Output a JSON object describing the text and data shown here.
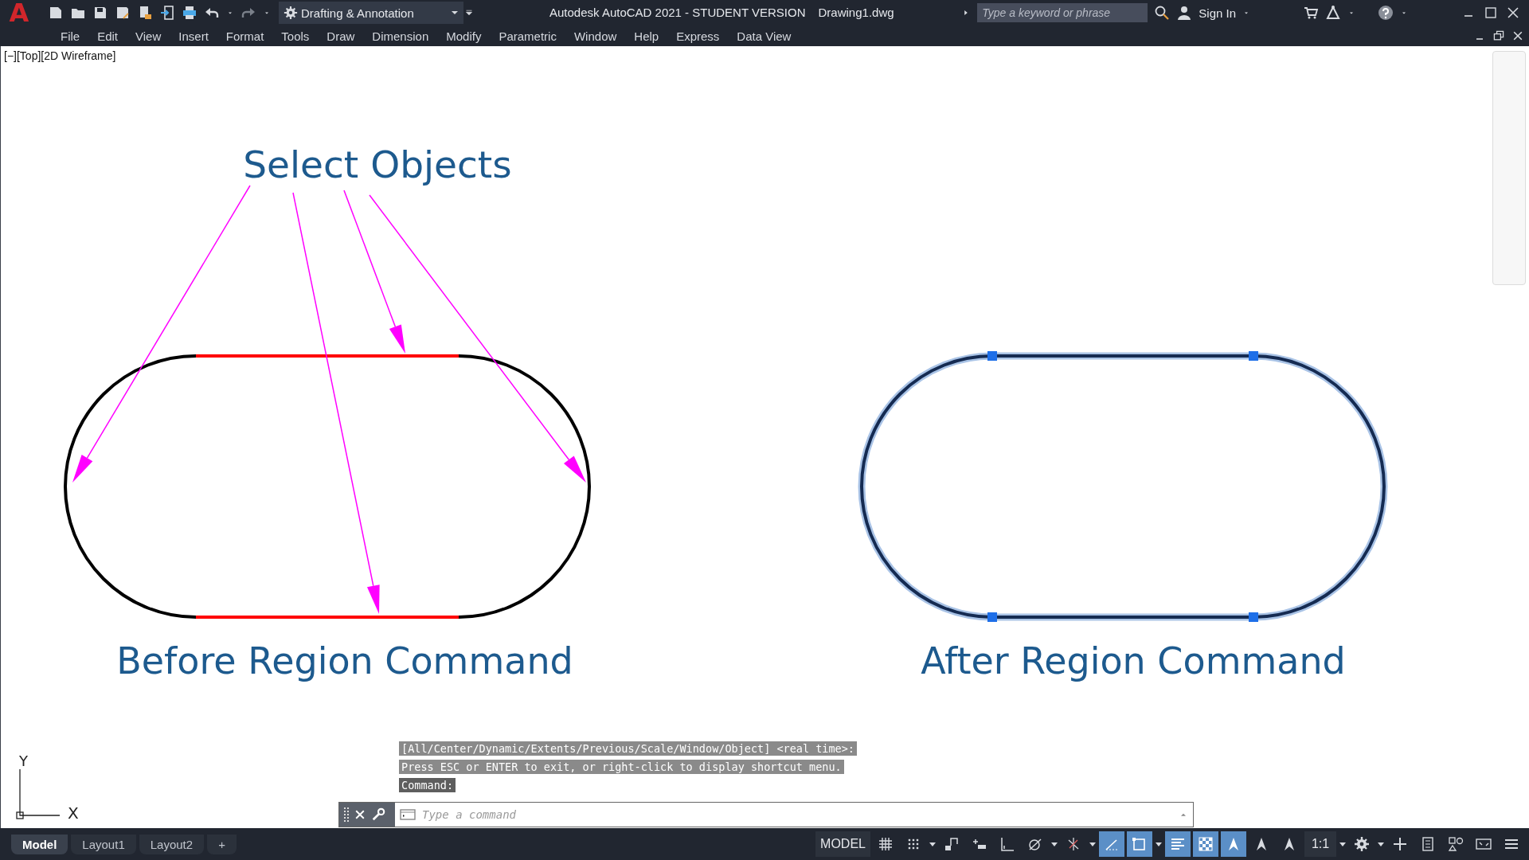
{
  "app": {
    "logo": "A",
    "workspace": "Drafting & Annotation",
    "title": "Autodesk AutoCAD 2021 - STUDENT VERSION",
    "file": "Drawing1.dwg",
    "search": {
      "placeholder": "Type a keyword or phrase"
    },
    "sign_in": "Sign In"
  },
  "menu": [
    "File",
    "Edit",
    "View",
    "Insert",
    "Format",
    "Tools",
    "Draw",
    "Dimension",
    "Modify",
    "Parametric",
    "Window",
    "Help",
    "Express",
    "Data View"
  ],
  "viewport_label": "[−][Top][2D Wireframe]",
  "drawing": {
    "callout": "Select Objects",
    "before_label": "Before Region Command",
    "after_label": "After Region Command"
  },
  "ucs": {
    "y": "Y",
    "x": "X"
  },
  "command_history": [
    {
      "text": "[All/Center/Dynamic/Extents/Previous/Scale/Window/Object] <real time>:",
      "kind": "prompt"
    },
    {
      "text": "Press ESC or ENTER to exit, or right-click to display shortcut menu.",
      "kind": "prompt"
    },
    {
      "text": "Command:",
      "kind": "command"
    }
  ],
  "command_line": {
    "placeholder": "Type a command"
  },
  "layout_tabs": [
    {
      "label": "Model",
      "selected": true
    },
    {
      "label": "Layout1",
      "selected": false
    },
    {
      "label": "Layout2",
      "selected": false
    },
    {
      "label": "+",
      "selected": false
    }
  ],
  "status_bar": [
    {
      "kind": "label",
      "text": "MODEL",
      "on": false
    },
    {
      "kind": "grid",
      "on": false
    },
    {
      "kind": "dots",
      "on": false
    },
    {
      "kind": "caret",
      "on": false
    },
    {
      "kind": "step",
      "on": false
    },
    {
      "kind": "infer",
      "on": false
    },
    {
      "kind": "ortho",
      "on": false
    },
    {
      "kind": "polar",
      "on": false
    },
    {
      "kind": "caret",
      "on": false
    },
    {
      "kind": "iso",
      "on": false
    },
    {
      "kind": "caret",
      "on": false
    },
    {
      "kind": "track",
      "on": true
    },
    {
      "kind": "osnap",
      "on": true
    },
    {
      "kind": "caret",
      "on": false
    },
    {
      "kind": "lines",
      "on": true
    },
    {
      "kind": "checker",
      "on": true
    },
    {
      "kind": "annot",
      "on": true
    },
    {
      "kind": "annot",
      "on": false
    },
    {
      "kind": "annot",
      "on": false
    },
    {
      "kind": "label",
      "text": "1:1",
      "on": false
    },
    {
      "kind": "caret",
      "on": false
    },
    {
      "kind": "gear",
      "on": false
    },
    {
      "kind": "caret",
      "on": false
    },
    {
      "kind": "plus",
      "on": false
    },
    {
      "kind": "calc",
      "on": false
    },
    {
      "kind": "shapes",
      "on": false
    },
    {
      "kind": "screen",
      "on": false
    },
    {
      "kind": "menu",
      "on": false
    }
  ]
}
